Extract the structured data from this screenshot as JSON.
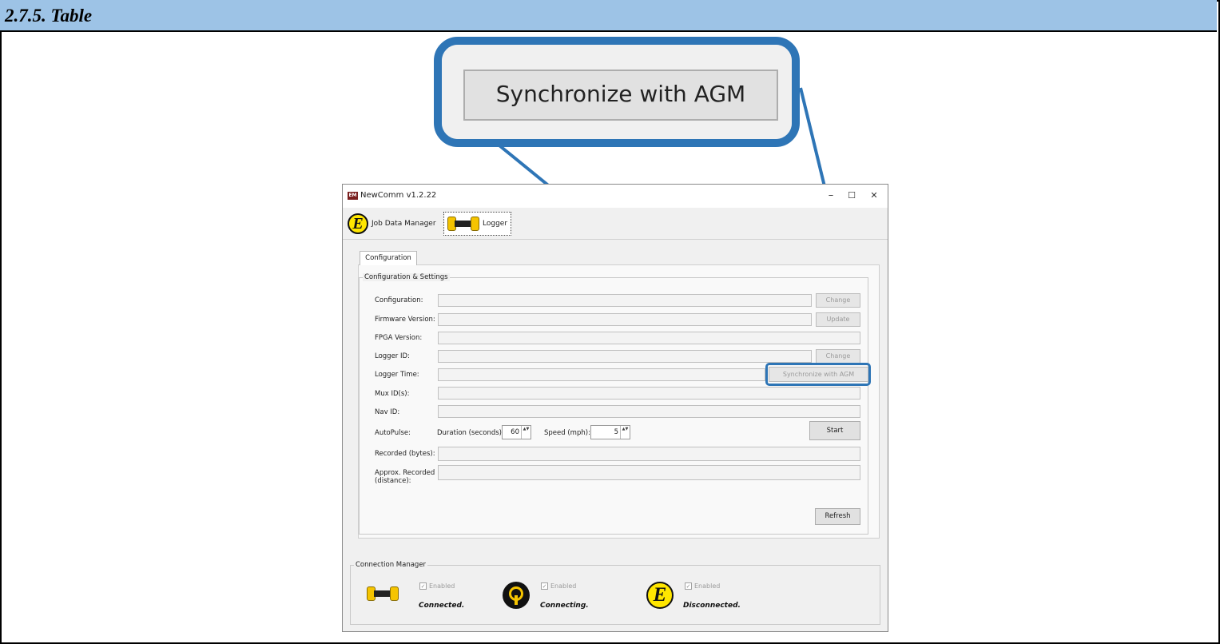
{
  "doc": {
    "heading": "2.7.5. Table"
  },
  "callout": {
    "button_label": "Synchronize with AGM"
  },
  "window": {
    "title": "NewComm v1.2.22",
    "app_icon_text": "EM",
    "controls": {
      "minimize": "–",
      "maximize": "☐",
      "close": "✕"
    }
  },
  "toolbar": {
    "job_data_manager": "Job Data Manager",
    "logger": "Logger",
    "e_logo_letter": "E"
  },
  "tabs": {
    "configuration": "Configuration"
  },
  "settings": {
    "group_title": "Configuration & Settings",
    "rows": {
      "configuration": "Configuration:",
      "firmware_version": "Firmware Version:",
      "fpga_version": "FPGA Version:",
      "logger_id": "Logger ID:",
      "logger_time": "Logger Time:",
      "mux_ids": "Mux ID(s):",
      "nav_id": "Nav ID:",
      "autopulse": "AutoPulse:",
      "recorded_bytes": "Recorded (bytes):",
      "approx_recorded_1": "Approx. Recorded",
      "approx_recorded_2": "(distance):"
    },
    "buttons": {
      "change_config": "Change",
      "update_firmware": "Update",
      "change_logger_id": "Change",
      "sync": "Synchronize with AGM",
      "start": "Start",
      "refresh": "Refresh"
    },
    "autopulse": {
      "duration_label": "Duration (seconds):",
      "duration_value": "60",
      "speed_label": "Speed (mph):",
      "speed_value": "5",
      "spin_arrows": "▲▼"
    }
  },
  "connection": {
    "group_title": "Connection Manager",
    "items": [
      {
        "enabled_label": "Enabled",
        "status": "Connected.",
        "device_icon": "logger-icon"
      },
      {
        "enabled_label": "Enabled",
        "status": "Connecting.",
        "device_icon": "radar-icon"
      },
      {
        "enabled_label": "Enabled",
        "status": "Disconnected.",
        "device_icon": "e-logo-icon"
      }
    ],
    "check_glyph": "✓"
  },
  "colors": {
    "header_bg": "#9dc3e6",
    "callout_border": "#2e75b6",
    "logo_yellow": "#ffe600"
  }
}
